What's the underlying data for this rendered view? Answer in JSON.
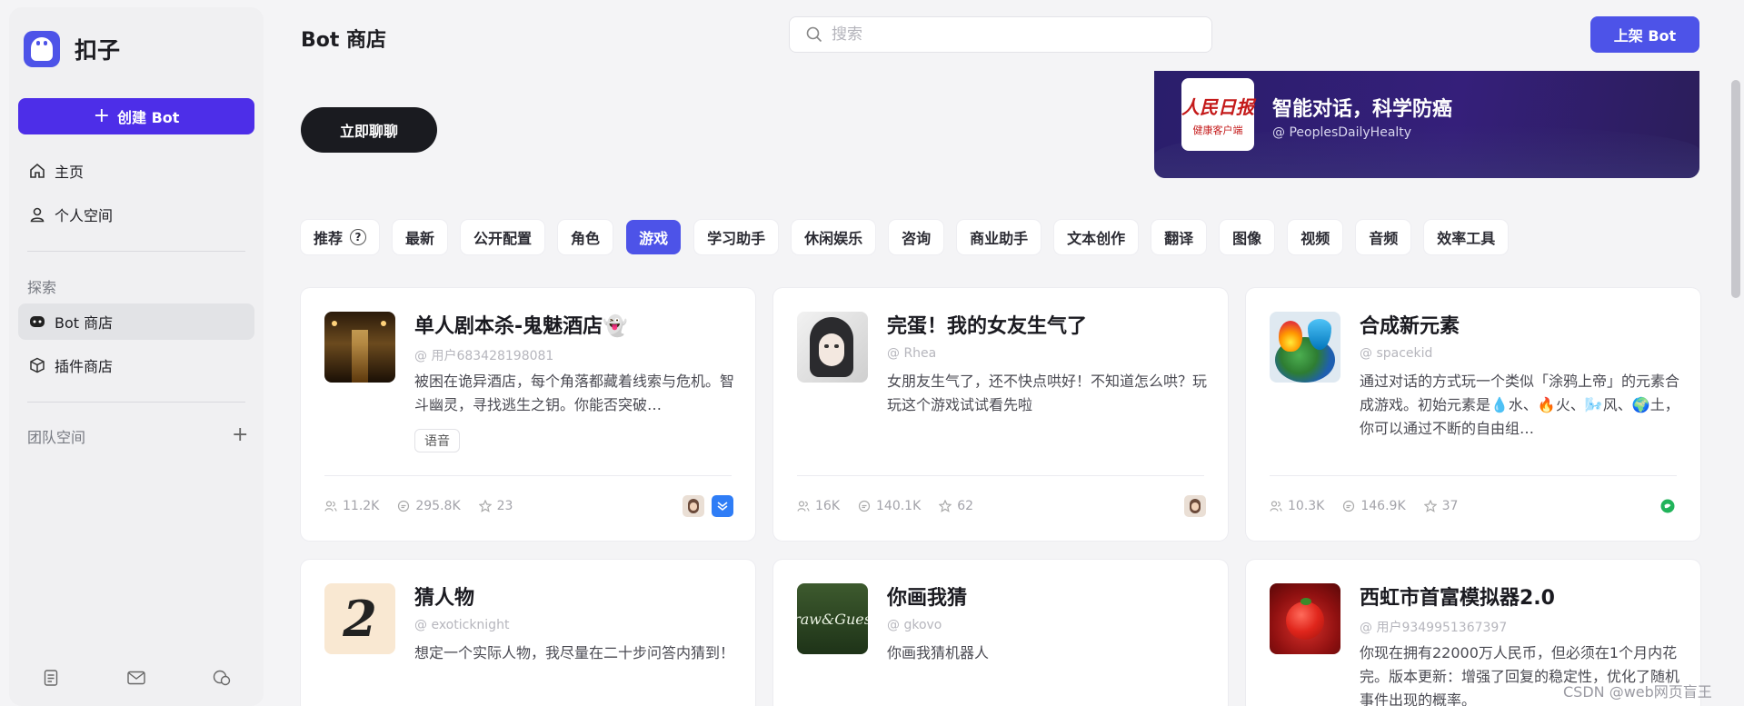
{
  "app": {
    "name": "扣子"
  },
  "sidebar": {
    "create_label": "创建 Bot",
    "nav": [
      {
        "label": "主页",
        "icon": "home-icon"
      },
      {
        "label": "个人空间",
        "icon": "user-icon"
      }
    ],
    "explore_label": "探索",
    "explore_items": [
      {
        "label": "Bot 商店",
        "icon": "bot-icon",
        "active": true
      },
      {
        "label": "插件商店",
        "icon": "cube-icon"
      }
    ],
    "team_label": "团队空间"
  },
  "header": {
    "title": "Bot 商店",
    "search_placeholder": "搜索",
    "publish_label": "上架 Bot"
  },
  "hero": {
    "chat_label": "立即聊聊"
  },
  "banner": {
    "logo_main": "人民日报",
    "logo_sub": "健康客户端",
    "title": "智能对话，科学防癌",
    "handle": "@ PeoplesDailyHealty"
  },
  "tabs": [
    {
      "label": "推荐",
      "help": "?"
    },
    {
      "label": "最新"
    },
    {
      "label": "公开配置"
    },
    {
      "label": "角色"
    },
    {
      "label": "游戏",
      "active": true
    },
    {
      "label": "学习助手"
    },
    {
      "label": "休闲娱乐"
    },
    {
      "label": "咨询"
    },
    {
      "label": "商业助手"
    },
    {
      "label": "文本创作"
    },
    {
      "label": "翻译"
    },
    {
      "label": "图像"
    },
    {
      "label": "视频"
    },
    {
      "label": "音频"
    },
    {
      "label": "效率工具"
    }
  ],
  "cards": [
    {
      "title": "单人剧本杀-鬼魅酒店👻",
      "author": "@ 用户683428198081",
      "desc": "被困在诡异酒店，每个角落都藏着线索与危机。智斗幽灵，寻找逃生之钥。你能否突破…",
      "tag": "语音",
      "users": "11.2K",
      "chats": "295.8K",
      "stars": "23"
    },
    {
      "title": "完蛋！我的女友生气了",
      "author": "@ Rhea",
      "desc": "女朋友生气了，还不快点哄好！不知道怎么哄？玩玩这个游戏试试看先啦",
      "users": "16K",
      "chats": "140.1K",
      "stars": "62"
    },
    {
      "title": "合成新元素",
      "author": "@ spacekid",
      "desc": "通过对话的方式玩一个类似「涂鸦上帝」的元素合成游戏。初始元素是💧水、🔥火、🌬️风、🌍土，你可以通过不断的自由组…",
      "users": "10.3K",
      "chats": "146.9K",
      "stars": "37"
    },
    {
      "title": "猜人物",
      "author": "@ exoticknight",
      "desc": "想定一个实际人物，我尽量在二十步问答内猜到！"
    },
    {
      "title": "你画我猜",
      "author": "@ gkovo",
      "desc": "你画我猜机器人"
    },
    {
      "title": "西虹市首富模拟器2.0",
      "author": "@ 用户9349951367397",
      "desc": "你现在拥有22000万人民币，但必须在1个月内花完。版本更新：增强了回复的稳定性，优化了随机事件出现的概率。"
    }
  ],
  "watermark": "CSDN @web网页盲王",
  "colors": {
    "accent": "#4d53e8",
    "create": "#4d2ee8",
    "dark_button": "#1a1b20"
  }
}
